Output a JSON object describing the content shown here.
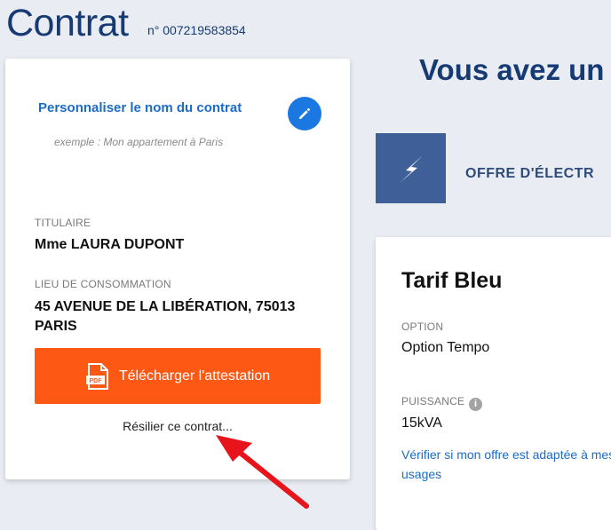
{
  "header": {
    "title": "Contrat",
    "contract_number": "n° 007219583854"
  },
  "contract_card": {
    "personalize_label": "Personnaliser le nom du contrat",
    "example_text": "exemple : Mon appartement à Paris",
    "holder_label": "TITULAIRE",
    "holder_value": "Mme LAURA DUPONT",
    "location_label": "LIEU DE CONSOMMATION",
    "location_line1": "45 AVENUE DE LA LIBÉRATION, 75013",
    "location_line2": "PARIS",
    "download_label": "Télécharger l'attestation",
    "download_icon_text": "PDF",
    "cancel_label": "Résilier ce contrat..."
  },
  "offer": {
    "headline": "Vous avez un",
    "offer_label": "OFFRE D'ÉLECTR",
    "icon": "lightning-icon"
  },
  "tarif_card": {
    "title": "Tarif Bleu",
    "option_label": "OPTION",
    "option_value": "Option Tempo",
    "power_label": "PUISSANCE",
    "info_glyph": "i",
    "power_value": "15kVA",
    "verify_link": "Vérifier si mon offre est adaptée à mes usages"
  },
  "colors": {
    "brand_blue": "#163a73",
    "link_blue": "#1b6bc8",
    "accent_orange": "#fe5815",
    "annotation_red": "#e8141b"
  }
}
